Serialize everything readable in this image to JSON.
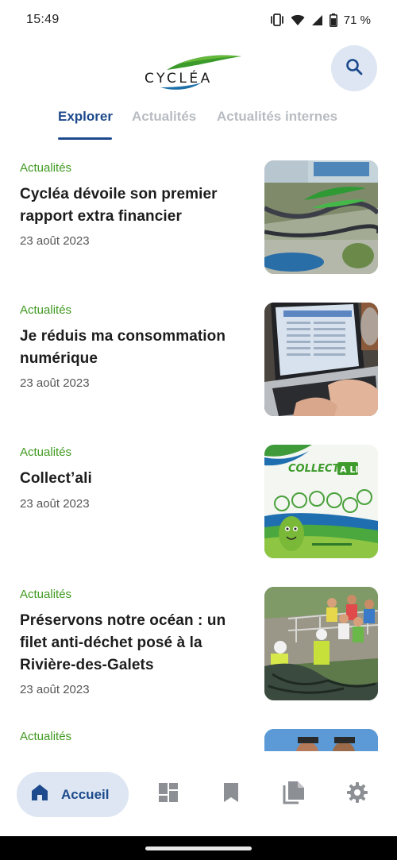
{
  "status": {
    "time": "15:49",
    "battery": "71 %"
  },
  "header": {
    "logo_text": "CYCLÉA",
    "icons": {
      "search": "search-icon"
    }
  },
  "tabs": [
    {
      "label": "Explorer",
      "active": true
    },
    {
      "label": "Actualités",
      "active": false
    },
    {
      "label": "Actualités internes",
      "active": false
    }
  ],
  "articles": [
    {
      "category": "Actualités",
      "title": "Cycléa dévoile son premier rapport extra financier",
      "date": "23 août 2023",
      "thumb": "aerial-ground-logo"
    },
    {
      "category": "Actualités",
      "title": "Je réduis ma consommation numérique",
      "date": "23 août 2023",
      "thumb": "laptop-keyboard"
    },
    {
      "category": "Actualités",
      "title": "Collect’ali",
      "date": "23 août 2023",
      "thumb": "collect-ali-poster"
    },
    {
      "category": "Actualités",
      "title": "Préservons notre océan : un filet anti-déchet posé à la Rivière-des-Galets",
      "date": "23 août 2023",
      "thumb": "net-installation"
    },
    {
      "category": "Actualités",
      "title": "",
      "date": "",
      "thumb": "people-outdoors"
    }
  ],
  "poster": {
    "heading": "COLLECT",
    "heading_badge": "A LI"
  },
  "bottom_nav": {
    "home_label": "Accueil",
    "icons": [
      "home-icon",
      "dashboard-icon",
      "bookmark-icon",
      "documents-icon",
      "settings-icon"
    ]
  },
  "colors": {
    "accent": "#1d4a8c",
    "accent_bg": "#dde6f2",
    "category": "#3f9a1f",
    "inactive_tab": "#b8bcc2"
  }
}
